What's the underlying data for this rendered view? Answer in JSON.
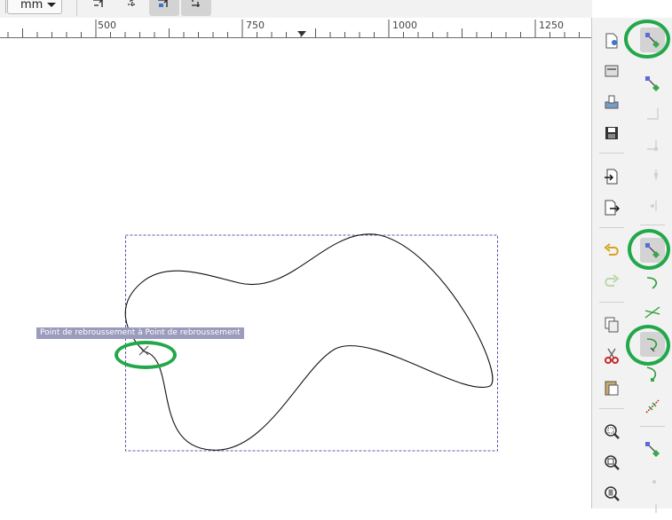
{
  "toolbar": {
    "unit": "mm",
    "buttons": [
      {
        "name": "snap-toggle-a",
        "active": false
      },
      {
        "name": "snap-toggle-b",
        "active": false
      },
      {
        "name": "snap-toggle-c",
        "active": true
      },
      {
        "name": "snap-toggle-d",
        "active": true
      }
    ]
  },
  "ruler": {
    "labels": [
      "500",
      "750",
      "1000",
      "1250"
    ]
  },
  "canvas": {
    "tooltip": "Point de rebroussement à Point de rebroussement"
  },
  "commands": [
    {
      "name": "new-document-icon"
    },
    {
      "name": "open-document-icon"
    },
    {
      "name": "print-icon"
    },
    {
      "name": "save-icon"
    },
    {
      "name": "import-icon"
    },
    {
      "name": "export-icon"
    },
    {
      "name": "undo-icon"
    },
    {
      "name": "redo-icon"
    },
    {
      "name": "copy-icon"
    },
    {
      "name": "cut-icon"
    },
    {
      "name": "paste-icon"
    },
    {
      "name": "zoom-selection-icon"
    },
    {
      "name": "zoom-drawing-icon"
    },
    {
      "name": "zoom-page-icon"
    }
  ],
  "snap_controls": [
    {
      "name": "snap-global-toggle-icon",
      "active": true
    },
    {
      "name": "snap-bounding-box-icon",
      "active": false
    },
    {
      "name": "snap-bbox-edges-icon",
      "active": false
    },
    {
      "name": "snap-bbox-corners-icon",
      "active": false
    },
    {
      "name": "snap-bbox-midpoints-icon",
      "active": false
    },
    {
      "name": "snap-bbox-centers-icon",
      "active": false
    },
    {
      "name": "snap-nodes-icon",
      "active": true
    },
    {
      "name": "snap-paths-icon",
      "active": false
    },
    {
      "name": "snap-path-intersections-icon",
      "active": false
    },
    {
      "name": "snap-cusp-nodes-icon",
      "active": true
    },
    {
      "name": "snap-smooth-nodes-icon",
      "active": false
    },
    {
      "name": "snap-line-midpoints-icon",
      "active": false
    },
    {
      "name": "snap-others-icon",
      "active": false
    },
    {
      "name": "snap-object-centers-icon",
      "active": false
    }
  ],
  "colors": {
    "highlight_ring": "#22a84a",
    "selection_box": "#5a5aa8",
    "tooltip_bg": "#9b9bbd"
  }
}
